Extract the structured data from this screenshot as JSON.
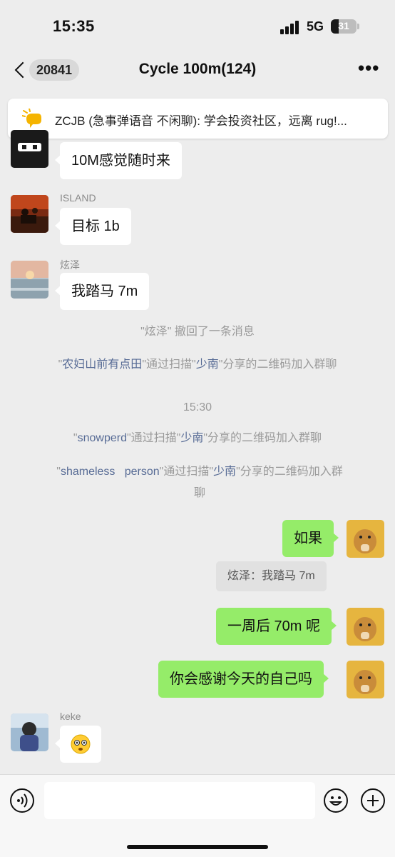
{
  "status_bar": {
    "time": "15:35",
    "network": "5G",
    "battery_level": "31",
    "battery_fraction": 0.31
  },
  "nav": {
    "unread_count": "20841",
    "title": "Cycle 100m(124)",
    "more_icon": "more-icon",
    "back_icon": "chevron-left-icon"
  },
  "pinned": {
    "icon": "megaphone-icon",
    "text": "ZCJB (急事弹语音 不闲聊): 学会投资社区，远离 rug!..."
  },
  "messages": {
    "m1": {
      "text": "10M感觉随时来"
    },
    "m2": {
      "sender": "ISLAND",
      "text": "目标 1b"
    },
    "m3": {
      "sender": "炫泽",
      "text": "我踏马 7m"
    },
    "sys1": {
      "text": "\"炫泽\" 撤回了一条消息"
    },
    "sys2": {
      "pre": "\"",
      "name1": "农妇山前有点田",
      "mid": "\"通过扫描\"",
      "name2": "少南",
      "post": "\"分享的二维码加入群聊"
    },
    "time_divider": "15:30",
    "sys3": {
      "pre": "\"",
      "name1": "snowperd",
      "mid": "\"通过扫描\"",
      "name2": "少南",
      "post": "\"分享的二维码加入群聊"
    },
    "sys4": {
      "pre": "\"",
      "name1": "shameless   person",
      "mid": "\"通过扫描\"",
      "name2": "少南",
      "post": "\"分享的二维码加入群",
      "post2": "聊"
    },
    "out1": {
      "text": "如果"
    },
    "quote": {
      "text": "炫泽：我踏马 7m"
    },
    "out2": {
      "text": "一周后 70m 呢"
    },
    "out3": {
      "text": "你会感谢今天的自己吗"
    },
    "m4": {
      "sender": "keke",
      "emoji": "flushed-face-emoji"
    }
  },
  "input_bar": {
    "voice_icon": "voice-icon",
    "emoji_icon": "smiley-icon",
    "plus_icon": "plus-icon"
  },
  "colors": {
    "background": "#ededed",
    "outgoing_bubble": "#95ec69",
    "incoming_bubble": "#ffffff",
    "link_name": "#576b95"
  }
}
